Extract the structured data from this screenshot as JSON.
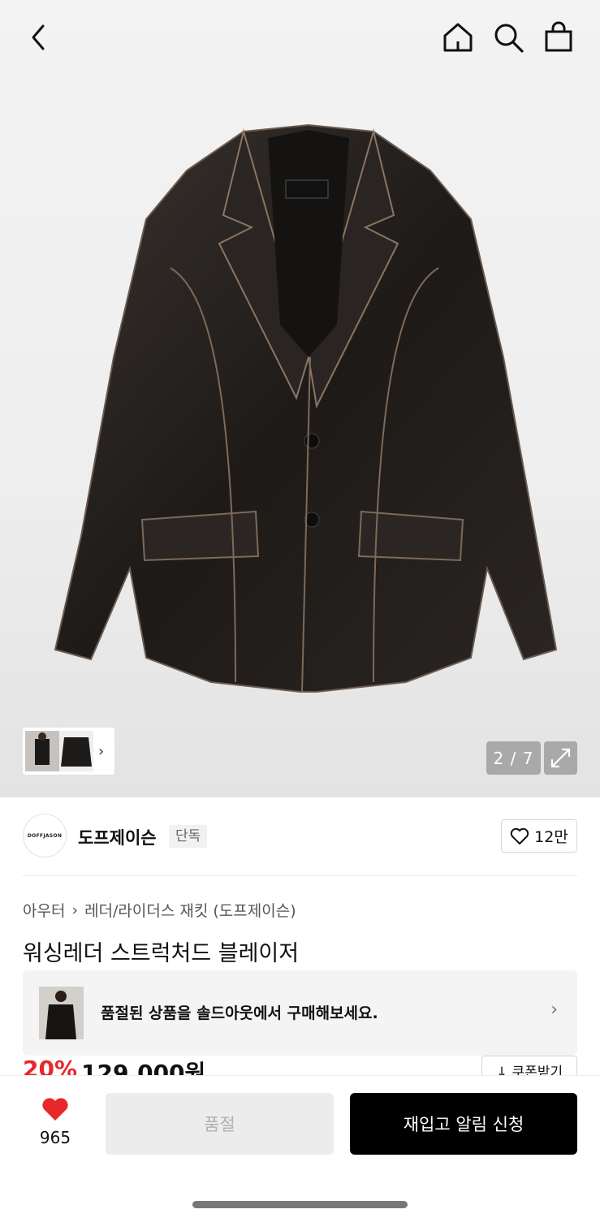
{
  "nav": {
    "back_icon": "chevron-left-icon",
    "home_icon": "home-icon",
    "search_icon": "search-icon",
    "bag_icon": "shopping-bag-icon"
  },
  "gallery": {
    "counter": "2 / 7",
    "expand_icon": "expand-icon",
    "thumbnails_more_icon": "chevron-right-icon"
  },
  "brand": {
    "logo_text": "DOFFJASON",
    "name": "도프제이슨",
    "tag": "단독",
    "likes": "12만"
  },
  "breadcrumb": {
    "category": "아우터",
    "subcategory": "레더/라이더스 재킷 (도프제이슨)"
  },
  "product": {
    "title": "워싱레더 스트럭처드 블레이저",
    "discount": "20%",
    "price": "129,000원",
    "coupon_label": "↓ 쿠폰받기"
  },
  "soldout_banner": {
    "text": "품절된 상품을 솔드아웃에서 구매해보세요."
  },
  "bottom_bar": {
    "wish_count": "965",
    "soldout_label": "품절",
    "restock_label": "재입고 알림 신청"
  },
  "colors": {
    "accent_red": "#e8272b",
    "primary_button": "#000000"
  }
}
